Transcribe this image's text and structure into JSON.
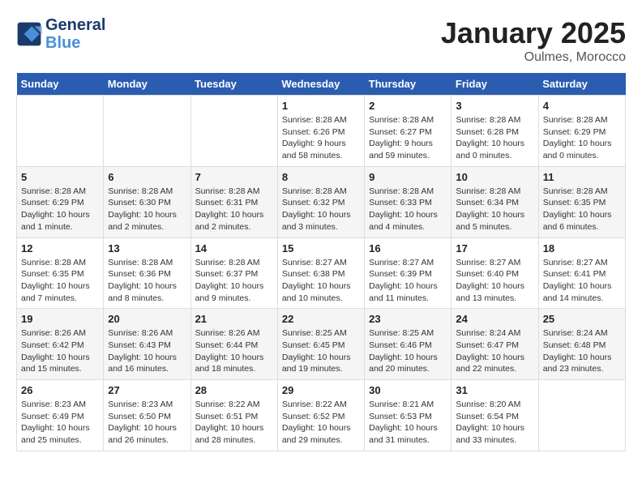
{
  "header": {
    "logo_line1": "General",
    "logo_line2": "Blue",
    "month": "January 2025",
    "location": "Oulmes, Morocco"
  },
  "weekdays": [
    "Sunday",
    "Monday",
    "Tuesday",
    "Wednesday",
    "Thursday",
    "Friday",
    "Saturday"
  ],
  "weeks": [
    [
      {
        "day": "",
        "info": ""
      },
      {
        "day": "",
        "info": ""
      },
      {
        "day": "",
        "info": ""
      },
      {
        "day": "1",
        "info": "Sunrise: 8:28 AM\nSunset: 6:26 PM\nDaylight: 9 hours\nand 58 minutes."
      },
      {
        "day": "2",
        "info": "Sunrise: 8:28 AM\nSunset: 6:27 PM\nDaylight: 9 hours\nand 59 minutes."
      },
      {
        "day": "3",
        "info": "Sunrise: 8:28 AM\nSunset: 6:28 PM\nDaylight: 10 hours\nand 0 minutes."
      },
      {
        "day": "4",
        "info": "Sunrise: 8:28 AM\nSunset: 6:29 PM\nDaylight: 10 hours\nand 0 minutes."
      }
    ],
    [
      {
        "day": "5",
        "info": "Sunrise: 8:28 AM\nSunset: 6:29 PM\nDaylight: 10 hours\nand 1 minute."
      },
      {
        "day": "6",
        "info": "Sunrise: 8:28 AM\nSunset: 6:30 PM\nDaylight: 10 hours\nand 2 minutes."
      },
      {
        "day": "7",
        "info": "Sunrise: 8:28 AM\nSunset: 6:31 PM\nDaylight: 10 hours\nand 2 minutes."
      },
      {
        "day": "8",
        "info": "Sunrise: 8:28 AM\nSunset: 6:32 PM\nDaylight: 10 hours\nand 3 minutes."
      },
      {
        "day": "9",
        "info": "Sunrise: 8:28 AM\nSunset: 6:33 PM\nDaylight: 10 hours\nand 4 minutes."
      },
      {
        "day": "10",
        "info": "Sunrise: 8:28 AM\nSunset: 6:34 PM\nDaylight: 10 hours\nand 5 minutes."
      },
      {
        "day": "11",
        "info": "Sunrise: 8:28 AM\nSunset: 6:35 PM\nDaylight: 10 hours\nand 6 minutes."
      }
    ],
    [
      {
        "day": "12",
        "info": "Sunrise: 8:28 AM\nSunset: 6:35 PM\nDaylight: 10 hours\nand 7 minutes."
      },
      {
        "day": "13",
        "info": "Sunrise: 8:28 AM\nSunset: 6:36 PM\nDaylight: 10 hours\nand 8 minutes."
      },
      {
        "day": "14",
        "info": "Sunrise: 8:28 AM\nSunset: 6:37 PM\nDaylight: 10 hours\nand 9 minutes."
      },
      {
        "day": "15",
        "info": "Sunrise: 8:27 AM\nSunset: 6:38 PM\nDaylight: 10 hours\nand 10 minutes."
      },
      {
        "day": "16",
        "info": "Sunrise: 8:27 AM\nSunset: 6:39 PM\nDaylight: 10 hours\nand 11 minutes."
      },
      {
        "day": "17",
        "info": "Sunrise: 8:27 AM\nSunset: 6:40 PM\nDaylight: 10 hours\nand 13 minutes."
      },
      {
        "day": "18",
        "info": "Sunrise: 8:27 AM\nSunset: 6:41 PM\nDaylight: 10 hours\nand 14 minutes."
      }
    ],
    [
      {
        "day": "19",
        "info": "Sunrise: 8:26 AM\nSunset: 6:42 PM\nDaylight: 10 hours\nand 15 minutes."
      },
      {
        "day": "20",
        "info": "Sunrise: 8:26 AM\nSunset: 6:43 PM\nDaylight: 10 hours\nand 16 minutes."
      },
      {
        "day": "21",
        "info": "Sunrise: 8:26 AM\nSunset: 6:44 PM\nDaylight: 10 hours\nand 18 minutes."
      },
      {
        "day": "22",
        "info": "Sunrise: 8:25 AM\nSunset: 6:45 PM\nDaylight: 10 hours\nand 19 minutes."
      },
      {
        "day": "23",
        "info": "Sunrise: 8:25 AM\nSunset: 6:46 PM\nDaylight: 10 hours\nand 20 minutes."
      },
      {
        "day": "24",
        "info": "Sunrise: 8:24 AM\nSunset: 6:47 PM\nDaylight: 10 hours\nand 22 minutes."
      },
      {
        "day": "25",
        "info": "Sunrise: 8:24 AM\nSunset: 6:48 PM\nDaylight: 10 hours\nand 23 minutes."
      }
    ],
    [
      {
        "day": "26",
        "info": "Sunrise: 8:23 AM\nSunset: 6:49 PM\nDaylight: 10 hours\nand 25 minutes."
      },
      {
        "day": "27",
        "info": "Sunrise: 8:23 AM\nSunset: 6:50 PM\nDaylight: 10 hours\nand 26 minutes."
      },
      {
        "day": "28",
        "info": "Sunrise: 8:22 AM\nSunset: 6:51 PM\nDaylight: 10 hours\nand 28 minutes."
      },
      {
        "day": "29",
        "info": "Sunrise: 8:22 AM\nSunset: 6:52 PM\nDaylight: 10 hours\nand 29 minutes."
      },
      {
        "day": "30",
        "info": "Sunrise: 8:21 AM\nSunset: 6:53 PM\nDaylight: 10 hours\nand 31 minutes."
      },
      {
        "day": "31",
        "info": "Sunrise: 8:20 AM\nSunset: 6:54 PM\nDaylight: 10 hours\nand 33 minutes."
      },
      {
        "day": "",
        "info": ""
      }
    ]
  ]
}
